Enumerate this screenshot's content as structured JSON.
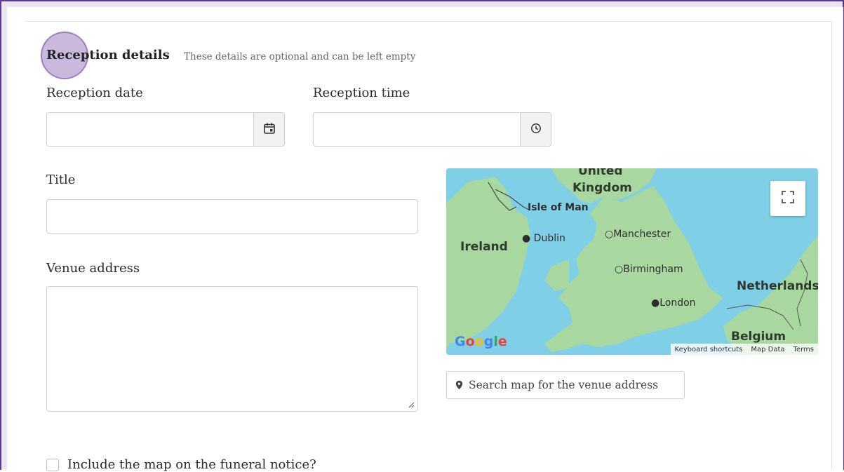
{
  "section": {
    "title": "Reception details",
    "hint": "These details are optional and can be left empty"
  },
  "fields": {
    "reception_date": {
      "label": "Reception date",
      "value": ""
    },
    "reception_time": {
      "label": "Reception time",
      "value": ""
    },
    "title": {
      "label": "Title",
      "value": ""
    },
    "venue_address": {
      "label": "Venue address",
      "value": ""
    }
  },
  "map": {
    "labels": {
      "united": "United",
      "kingdom": "Kingdom",
      "isle_of_man": "Isle of Man",
      "ireland": "Ireland",
      "dublin": "Dublin",
      "manchester": "Manchester",
      "birmingham": "Birmingham",
      "netherlands": "Netherlands",
      "london": "London",
      "belgium": "Belgium"
    },
    "logo": "Google",
    "footer": {
      "keyboard_shortcuts": "Keyboard shortcuts",
      "map_data": "Map Data",
      "terms": "Terms"
    },
    "colors": {
      "water": "#7fcfe6",
      "land": "#a8d8a0"
    }
  },
  "search_button": {
    "label": "Search map for the venue address"
  },
  "include_map": {
    "label": "Include the map on the funeral notice?",
    "checked": false
  },
  "icons": {
    "date": "calendar-icon",
    "time": "clock-icon",
    "fullscreen": "fullscreen-icon",
    "pin": "map-pin-icon"
  }
}
